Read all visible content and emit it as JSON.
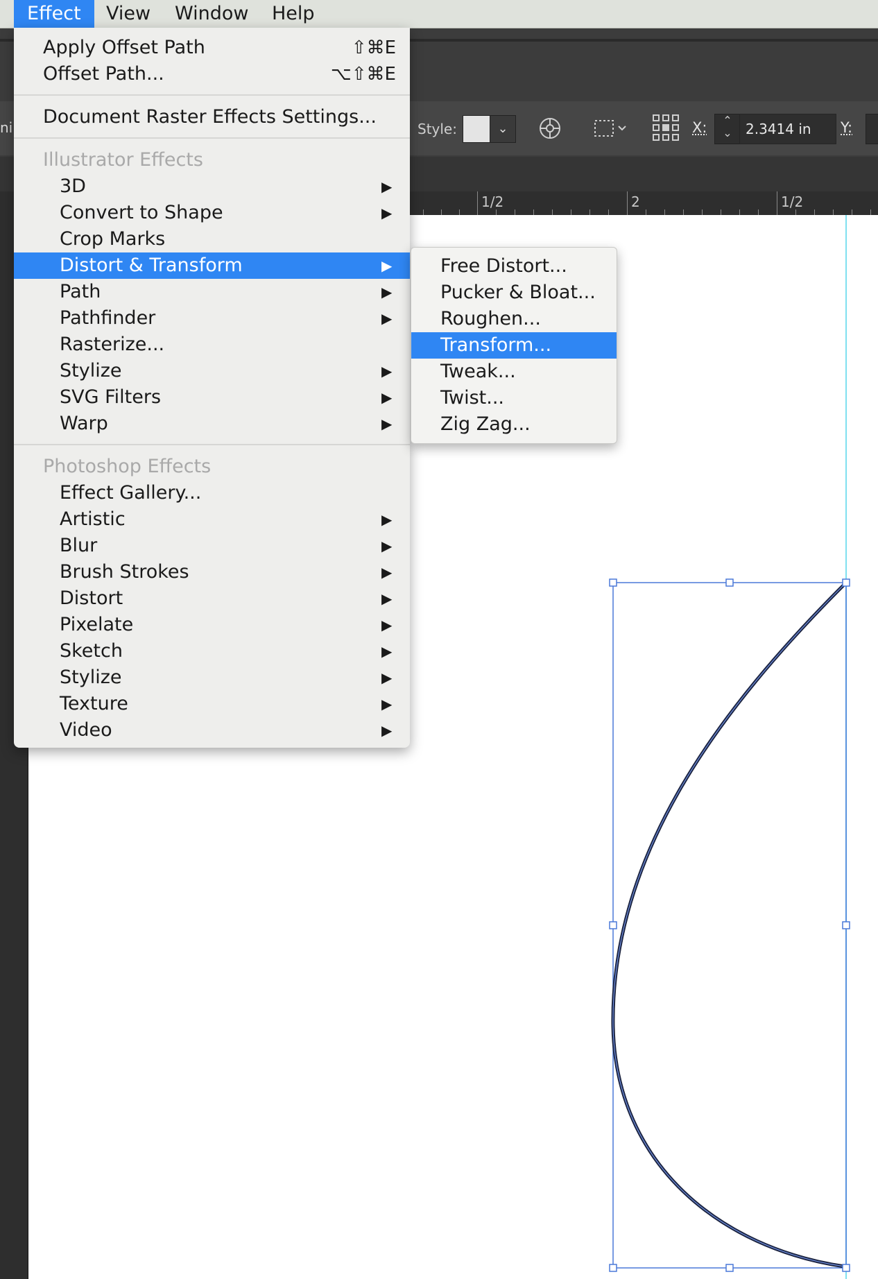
{
  "menubar": {
    "items": [
      {
        "label": "Effect",
        "active": true
      },
      {
        "label": "View"
      },
      {
        "label": "Window"
      },
      {
        "label": "Help"
      }
    ]
  },
  "control_bar": {
    "style_label": "Style:",
    "x_label": "X:",
    "x_value": "2.3414 in",
    "y_label": "Y:",
    "left_clip_text": "ni"
  },
  "ruler": {
    "labels": [
      "1/2",
      "2",
      "1/2"
    ]
  },
  "effect_menu": {
    "top_items": [
      {
        "label": "Apply Offset Path",
        "shortcut": "⇧⌘E"
      },
      {
        "label": "Offset Path...",
        "shortcut": "⌥⇧⌘E"
      }
    ],
    "document_item": "Document Raster Effects Settings...",
    "illustrator_header": "Illustrator Effects",
    "illustrator_items": [
      {
        "label": "3D",
        "submenu": true
      },
      {
        "label": "Convert to Shape",
        "submenu": true
      },
      {
        "label": "Crop Marks",
        "submenu": false
      },
      {
        "label": "Distort & Transform",
        "submenu": true,
        "highlighted": true
      },
      {
        "label": "Path",
        "submenu": true
      },
      {
        "label": "Pathfinder",
        "submenu": true
      },
      {
        "label": "Rasterize...",
        "submenu": false
      },
      {
        "label": "Stylize",
        "submenu": true
      },
      {
        "label": "SVG Filters",
        "submenu": true
      },
      {
        "label": "Warp",
        "submenu": true
      }
    ],
    "photoshop_header": "Photoshop Effects",
    "photoshop_items": [
      {
        "label": "Effect Gallery...",
        "submenu": false
      },
      {
        "label": "Artistic",
        "submenu": true
      },
      {
        "label": "Blur",
        "submenu": true
      },
      {
        "label": "Brush Strokes",
        "submenu": true
      },
      {
        "label": "Distort",
        "submenu": true
      },
      {
        "label": "Pixelate",
        "submenu": true
      },
      {
        "label": "Sketch",
        "submenu": true
      },
      {
        "label": "Stylize",
        "submenu": true
      },
      {
        "label": "Texture",
        "submenu": true
      },
      {
        "label": "Video",
        "submenu": true
      }
    ],
    "submenu_arrow": "▶"
  },
  "distort_submenu": {
    "items": [
      {
        "label": "Free Distort..."
      },
      {
        "label": "Pucker & Bloat..."
      },
      {
        "label": "Roughen..."
      },
      {
        "label": "Transform...",
        "highlighted": true
      },
      {
        "label": "Tweak..."
      },
      {
        "label": "Twist..."
      },
      {
        "label": "Zig Zag..."
      }
    ]
  },
  "colors": {
    "accent": "#2f86f3",
    "menu_bg": "#eeeeec",
    "header_gray": "#a9a9a9",
    "selection_blue": "#4a78d8",
    "guide_cyan": "#7fe0f0",
    "path_stroke": "#1c2440"
  }
}
